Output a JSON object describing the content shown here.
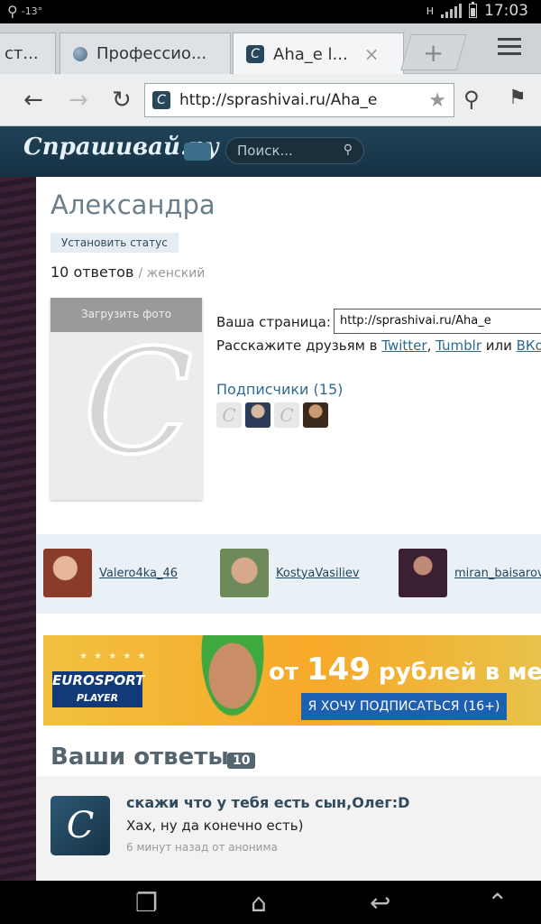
{
  "status_bar": {
    "temperature": "-13°",
    "time": "17:03",
    "network_label": "H"
  },
  "tabs": [
    {
      "label": "ст..."
    },
    {
      "label": "Профессио..."
    },
    {
      "label": "Aha_e l..."
    }
  ],
  "url_bar": {
    "url": "http://sprashivai.ru/Aha_e"
  },
  "site": {
    "logo_text": "Спрашивай.ру",
    "search_placeholder": "Поиск..."
  },
  "profile": {
    "name": "Александра",
    "set_status_label": "Установить статус",
    "answers_count_text": "10 ответов",
    "gender_text": "/ женский",
    "upload_photo_label": "Загрузить фото",
    "page_label": "Ваша страница:",
    "page_url": "http://sprashivai.ru/Aha_e",
    "share_prefix": "Расскажите друзьям в",
    "share_twitter": "Twitter",
    "share_tumblr": "Tumblr",
    "share_or": "или",
    "share_vk": "ВКо",
    "subscribers_title": "Подписчики (15)"
  },
  "people": [
    {
      "name": "Valero4ka_46"
    },
    {
      "name": "KostyaVasiliev"
    },
    {
      "name": "miran_baisarov"
    }
  ],
  "banner": {
    "brand": "EUROSPORT",
    "brand_sub": "PLAYER",
    "price_prefix": "от",
    "price_value": "149",
    "price_suffix": "рублей в месяц",
    "cta": "Я ХОЧУ ПОДПИСАТЬСЯ (16+)"
  },
  "your_answers": {
    "title": "Ваши ответы",
    "count": "10",
    "items": [
      {
        "question": "скажи что у тебя есть сын,Олег:D",
        "answer": "Хах, ну да конечно есть)",
        "time": "6 минут назад",
        "from": "от анонима"
      }
    ]
  },
  "colors": {
    "site_header": "#1f4258",
    "link": "#2a6a96",
    "accent_blue": "#1d5fb0"
  }
}
